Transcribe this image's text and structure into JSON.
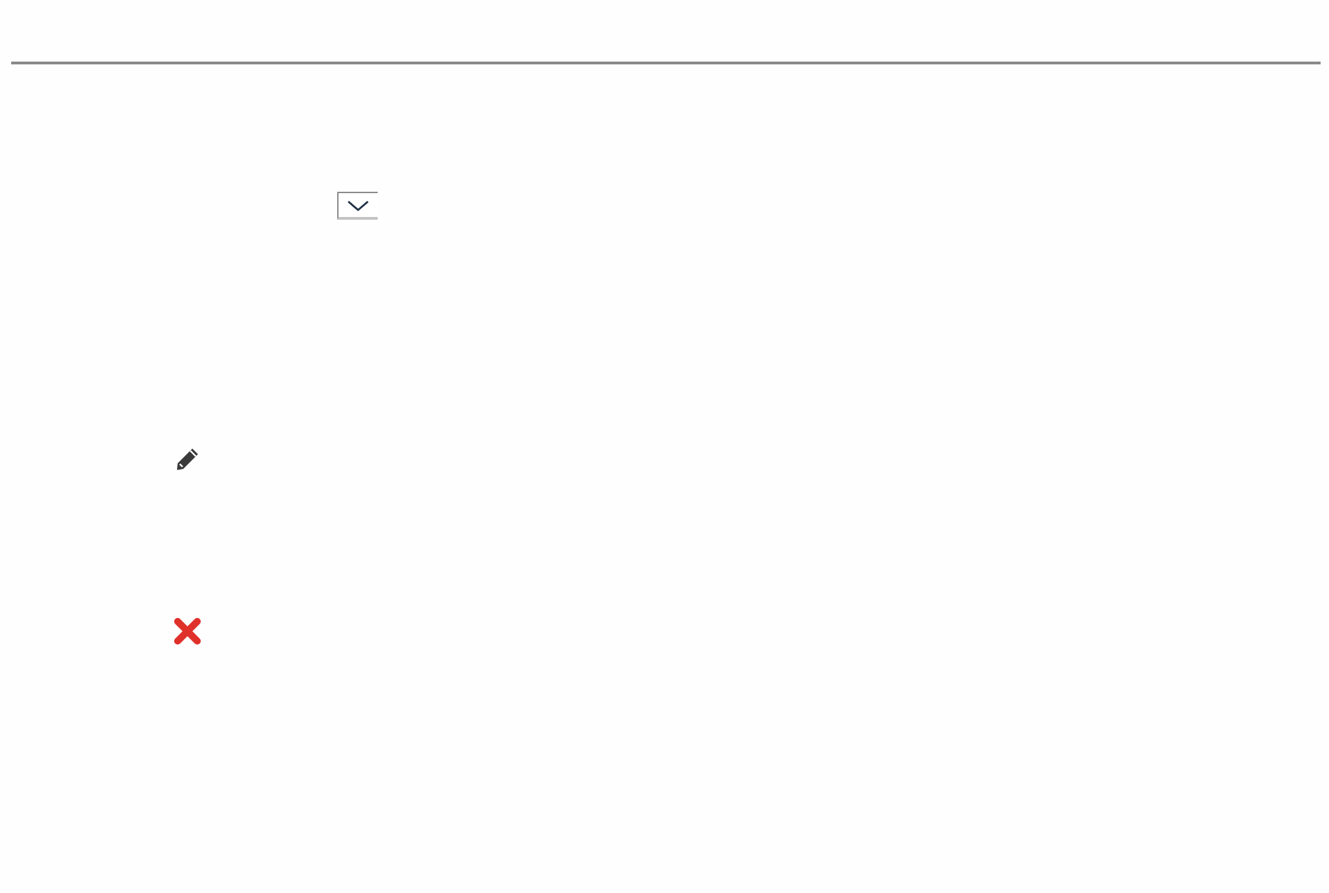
{
  "dropdown": {
    "expanded": false
  },
  "actions": [
    {
      "kind": "edit"
    },
    {
      "kind": "delete"
    }
  ]
}
